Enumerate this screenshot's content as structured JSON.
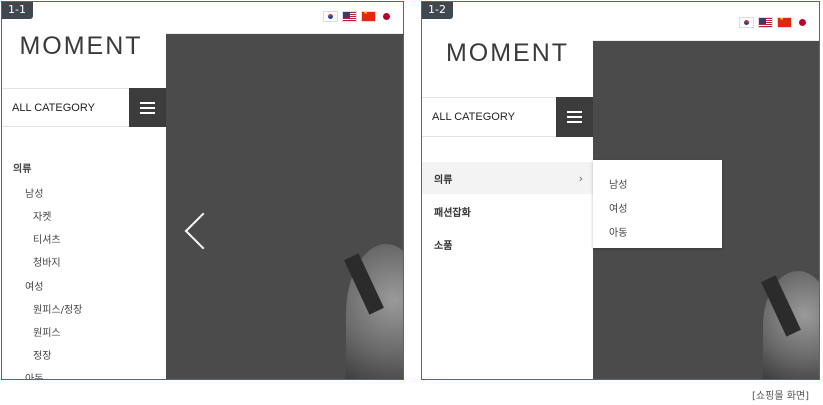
{
  "panel1": {
    "badge": "1-1",
    "logo": "MOMENT",
    "category_label": "ALL CATEGORY",
    "tree": [
      "의류",
      "남성",
      "자켓",
      "티셔츠",
      "청바지",
      "여성",
      "원피스/정장",
      "원피스",
      "정장",
      "아동"
    ],
    "flags": [
      "korea-flag-icon",
      "usa-flag-icon",
      "china-flag-icon",
      "japan-flag-icon"
    ]
  },
  "panel2": {
    "badge": "1-2",
    "logo": "MOMENT",
    "category_label": "ALL CATEGORY",
    "menu": [
      "의류",
      "패션잡화",
      "소품"
    ],
    "submenu": [
      "남성",
      "여성",
      "아동"
    ],
    "flags": [
      "korea-flag-icon",
      "usa-flag-icon",
      "china-flag-icon",
      "japan-flag-icon"
    ]
  },
  "caption": "[쇼핑몰 화면]"
}
